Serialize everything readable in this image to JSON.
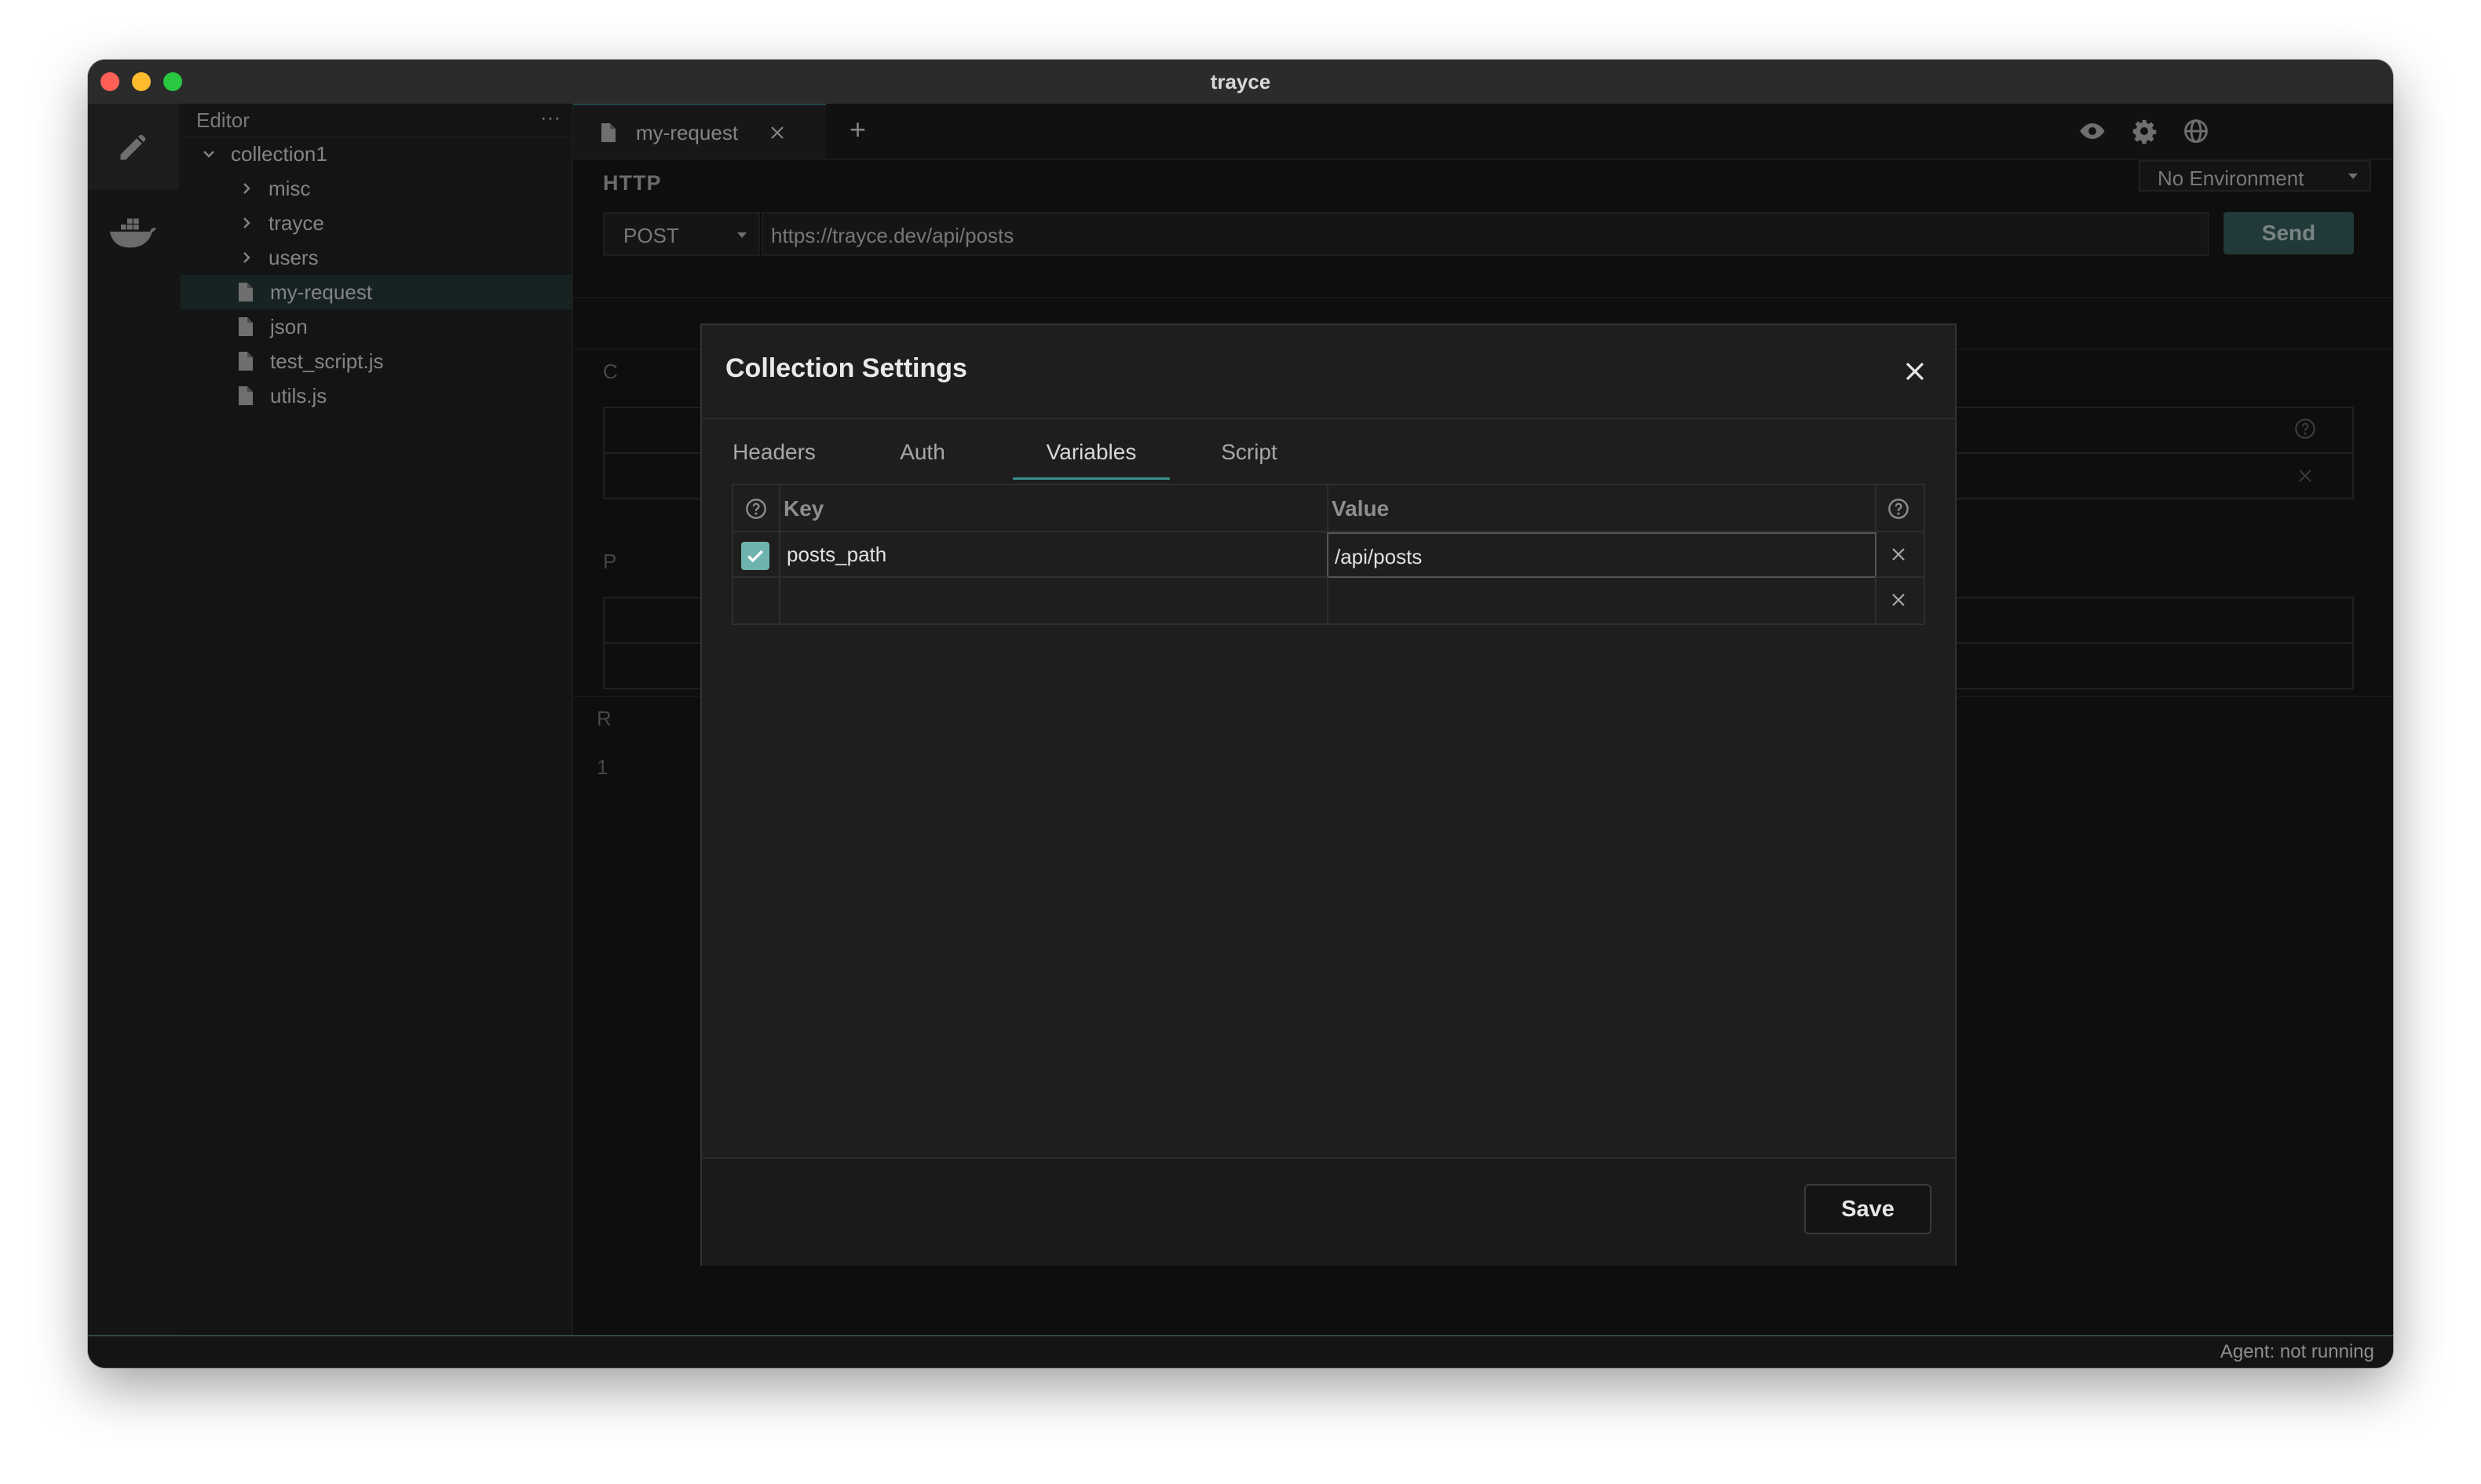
{
  "window": {
    "title": "trayce"
  },
  "activity_bar": {
    "items": [
      {
        "icon": "pencil-icon"
      },
      {
        "icon": "docker-icon"
      }
    ]
  },
  "sidebar": {
    "title": "Editor",
    "more_label": "···",
    "tree": [
      {
        "label": "collection1",
        "kind": "folder",
        "expanded": true,
        "depth": 0
      },
      {
        "label": "misc",
        "kind": "folder",
        "expanded": false,
        "depth": 1
      },
      {
        "label": "trayce",
        "kind": "folder",
        "expanded": false,
        "depth": 1
      },
      {
        "label": "users",
        "kind": "folder",
        "expanded": false,
        "depth": 1
      },
      {
        "label": "my-request",
        "kind": "file",
        "selected": true,
        "depth": 1
      },
      {
        "label": "json",
        "kind": "file",
        "depth": 1
      },
      {
        "label": "test_script.js",
        "kind": "file",
        "depth": 1
      },
      {
        "label": "utils.js",
        "kind": "file",
        "depth": 1
      }
    ]
  },
  "tabs": {
    "open": [
      {
        "label": "my-request"
      }
    ],
    "add_label": "+"
  },
  "toolbar": {
    "environment": "No Environment"
  },
  "request": {
    "section_label": "HTTP",
    "method": "POST",
    "url": "https://trayce.dev/api/posts",
    "send_label": "Send"
  },
  "background_fragments": {
    "a": "C",
    "b": "P",
    "c": "R",
    "d": "1"
  },
  "dialog": {
    "title": "Collection Settings",
    "tabs": [
      {
        "label": "Headers"
      },
      {
        "label": "Auth"
      },
      {
        "label": "Variables",
        "active": true
      },
      {
        "label": "Script"
      }
    ],
    "table": {
      "key_header": "Key",
      "value_header": "Value",
      "rows": [
        {
          "enabled": true,
          "key": "posts_path",
          "value": "/api/posts"
        },
        {
          "enabled": false,
          "key": "",
          "value": ""
        }
      ]
    },
    "save_label": "Save"
  },
  "statusbar": {
    "text": "Agent: not running"
  },
  "colors": {
    "accent": "#6fb3ae",
    "send_button": "#2c4a4a",
    "traffic_red": "#fe5f57",
    "traffic_yellow": "#febc2e",
    "traffic_green": "#28c840"
  }
}
